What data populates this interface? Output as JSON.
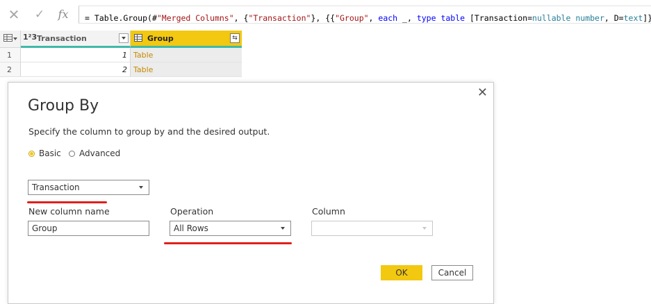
{
  "formula_bar": {
    "formula_prefix": "= ",
    "formula_parts": [
      {
        "t": "Table.Group(#",
        "c": "tk-fn"
      },
      {
        "t": "\"Merged Columns\"",
        "c": "tk-str"
      },
      {
        "t": ", {",
        "c": "tk-fn"
      },
      {
        "t": "\"Transaction\"",
        "c": "tk-str"
      },
      {
        "t": "}, {{",
        "c": "tk-fn"
      },
      {
        "t": "\"Group\"",
        "c": "tk-str"
      },
      {
        "t": ", ",
        "c": "tk-fn"
      },
      {
        "t": "each",
        "c": "tk-kw"
      },
      {
        "t": " _, ",
        "c": "tk-fn"
      },
      {
        "t": "type",
        "c": "tk-kw"
      },
      {
        "t": " ",
        "c": "tk-fn"
      },
      {
        "t": "table",
        "c": "tk-kw"
      },
      {
        "t": " [Transaction=",
        "c": "tk-fn"
      },
      {
        "t": "nullable",
        "c": "tk-ty"
      },
      {
        "t": " ",
        "c": "tk-fn"
      },
      {
        "t": "number",
        "c": "tk-ty"
      },
      {
        "t": ", D=",
        "c": "tk-fn"
      },
      {
        "t": "text",
        "c": "tk-ty"
      },
      {
        "t": "]}})",
        "c": "tk-fn"
      }
    ],
    "cancel_icon": "x-icon",
    "commit_icon": "check-icon",
    "fx_label": "fx"
  },
  "grid": {
    "columns": [
      {
        "type_icon": "1²3",
        "label": "Transaction"
      },
      {
        "type_icon": "table-icon",
        "label": "Group"
      }
    ],
    "rows": [
      {
        "num": "1",
        "transaction": "1",
        "group": "Table"
      },
      {
        "num": "2",
        "transaction": "2",
        "group": "Table"
      }
    ]
  },
  "dialog": {
    "title": "Group By",
    "description": "Specify the column to group by and the desired output.",
    "radio_basic": "Basic",
    "radio_advanced": "Advanced",
    "selected_mode": "Basic",
    "group_by_value": "Transaction",
    "new_column_label": "New column name",
    "new_column_value": "Group",
    "operation_label": "Operation",
    "operation_value": "All Rows",
    "column_label": "Column",
    "column_value": "",
    "ok_label": "OK",
    "cancel_label": "Cancel"
  },
  "colors": {
    "accent": "#f2c811",
    "column_quality": "#3fb9a8",
    "annotation_red": "#e0201b",
    "table_link": "#c48a00"
  }
}
